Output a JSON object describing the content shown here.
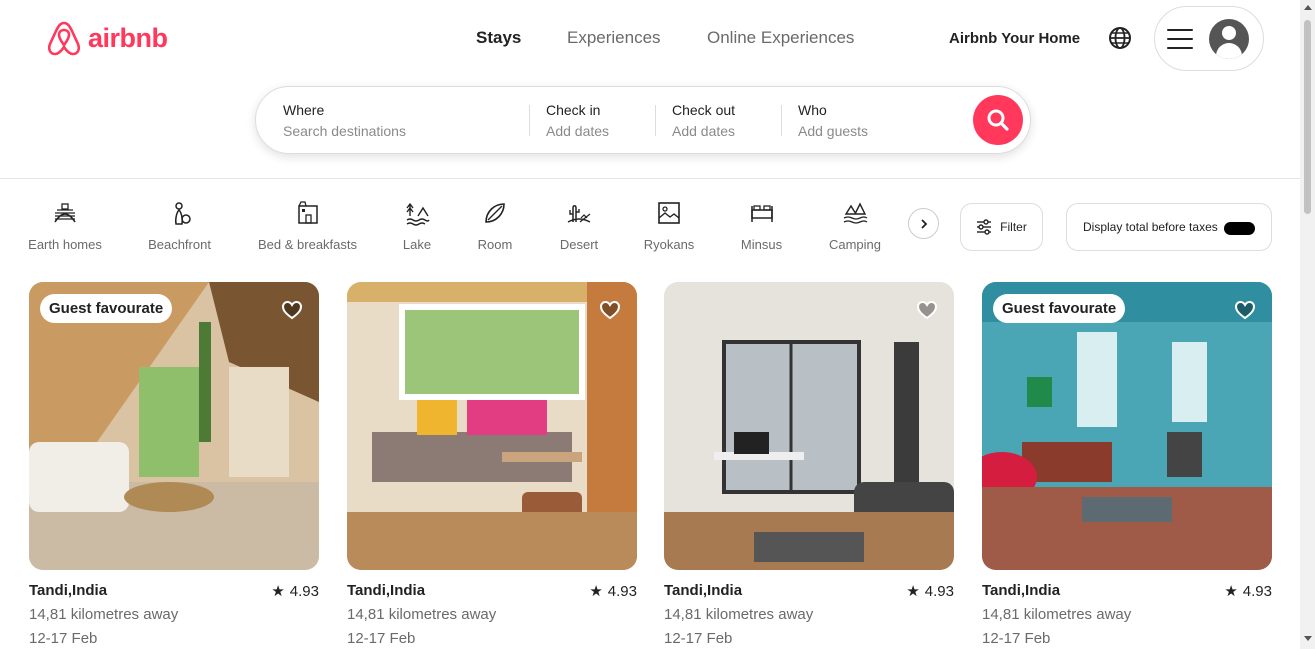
{
  "brand": {
    "name": "airbnb",
    "color": "#ff385c",
    "logo_icon": "airbnb-belo-icon"
  },
  "nav": {
    "stays": "Stays",
    "experiences": "Experiences",
    "online_experiences": "Online Experiences"
  },
  "header_right": {
    "host_link": "Airbnb Your Home",
    "globe_icon": "globe-icon",
    "menu_icon": "hamburger-icon",
    "avatar_icon": "user-avatar-icon"
  },
  "search": {
    "where_label": "Where",
    "where_placeholder": "Search destinations",
    "checkin_label": "Check in",
    "checkin_placeholder": "Add dates",
    "checkout_label": "Check out",
    "checkout_placeholder": "Add dates",
    "who_label": "Who",
    "who_placeholder": "Add guests",
    "button_icon": "search-icon"
  },
  "categories": [
    {
      "label": "Earth homes",
      "icon": "earth-home-icon"
    },
    {
      "label": "Beachfront",
      "icon": "beachfront-icon"
    },
    {
      "label": "Bed & breakfasts",
      "icon": "bed-breakfast-icon"
    },
    {
      "label": "Lake",
      "icon": "lake-icon"
    },
    {
      "label": "Room",
      "icon": "room-icon"
    },
    {
      "label": "Desert",
      "icon": "desert-icon"
    },
    {
      "label": "Ryokans",
      "icon": "ryokan-icon"
    },
    {
      "label": "Minsus",
      "icon": "minsu-icon"
    },
    {
      "label": "Camping",
      "icon": "camping-icon"
    }
  ],
  "filters": {
    "filter_label": "Filter",
    "tax_label": "Display total before taxes",
    "tax_toggle_on": true
  },
  "listings": [
    {
      "badge": "Guest favourate",
      "title": "Tandi,India",
      "rating": "4.93",
      "distance": "14,81 kilometres away",
      "dates": "12-17 Feb"
    },
    {
      "badge": "",
      "title": "Tandi,India",
      "rating": "4.93",
      "distance": "14,81 kilometres away",
      "dates": "12-17 Feb"
    },
    {
      "badge": "",
      "title": "Tandi,India",
      "rating": "4.93",
      "distance": "14,81 kilometres away",
      "dates": "12-17 Feb"
    },
    {
      "badge": "Guest favourate",
      "title": "Tandi,India",
      "rating": "4.93",
      "distance": "14,81 kilometres away",
      "dates": "12-17 Feb"
    }
  ]
}
